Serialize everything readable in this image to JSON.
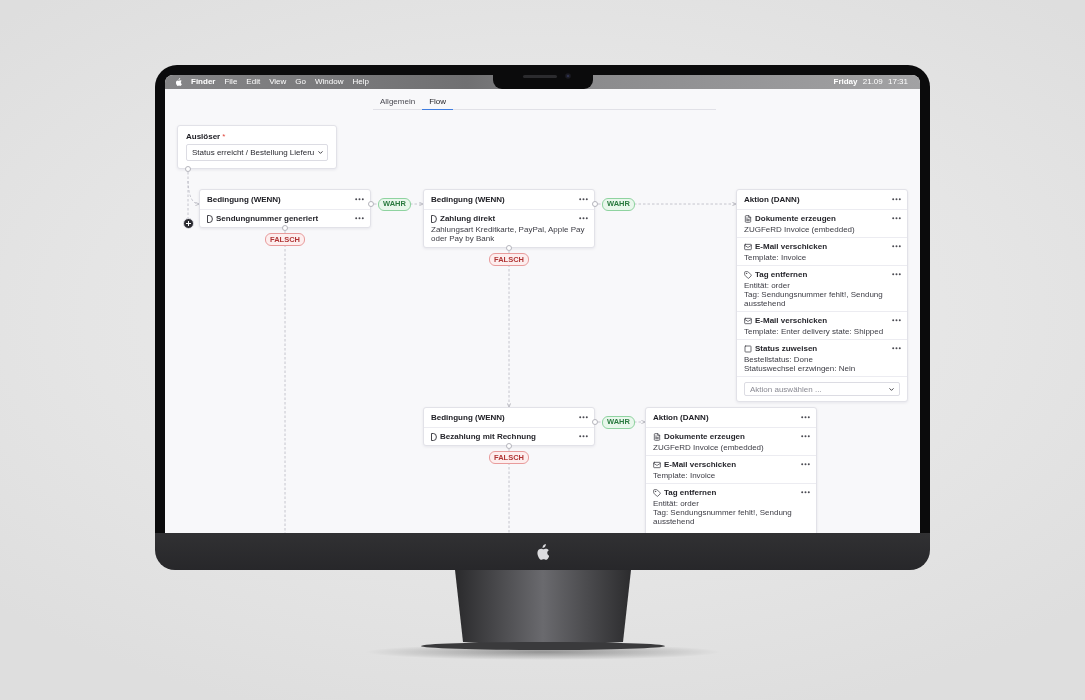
{
  "menu_bar": {
    "app_name": "Finder",
    "menus": [
      "File",
      "Edit",
      "View",
      "Go",
      "Window",
      "Help"
    ],
    "clock": "**Friday** 21.09 17:31"
  },
  "tabs": [
    {
      "label": "Allgemein",
      "selected": false
    },
    {
      "label": "Flow",
      "selected": true
    }
  ],
  "trigger": {
    "label": "Auslöser",
    "required_mark": "*",
    "select": {
      "value": "Status erreicht / Bestellung Lieferu"
    }
  },
  "conditions": [
    {
      "title": "Bedingung (WENN)",
      "rules": [
        {
          "name": "Sendungnummer generiert"
        }
      ],
      "true_label": "WAHR",
      "false_label": "FALSCH"
    },
    {
      "title": "Bedingung (WENN)",
      "rules": [
        {
          "name": "Zahlung direkt",
          "details": "Zahlungsart Kreditkarte, PayPal, Apple Pay oder Pay by Bank"
        }
      ],
      "true_label": "WAHR",
      "false_label": "FALSCH"
    },
    {
      "title": "Bedingung (WENN)",
      "rules": [
        {
          "name": "Bezahlung mit Rechnung"
        }
      ],
      "true_label": "WAHR",
      "false_label": "FALSCH"
    }
  ],
  "actions": [
    {
      "title": "Aktion (DANN)",
      "items": [
        {
          "kind": "documents",
          "name": "Dokumente erzeugen",
          "details": [
            "ZUGFeRD Invoice (embedded)"
          ]
        },
        {
          "kind": "email",
          "name": "E-Mail verschicken",
          "details": [
            "Template: Invoice"
          ]
        },
        {
          "kind": "tag",
          "name": "Tag entfernen",
          "details": [
            "Entität: order",
            "Tag: Sendungsnummer fehlt!, Sendung ausstehend"
          ]
        },
        {
          "kind": "email",
          "name": "E-Mail verschicken",
          "details": [
            "Template: Enter delivery state: Shipped"
          ]
        },
        {
          "kind": "status",
          "name": "Status zuweisen",
          "details": [
            "Bestellstatus: Done",
            "Statuswechsel erzwingen: Nein"
          ]
        }
      ],
      "select": {
        "placeholder": "Aktion auswählen ..."
      }
    },
    {
      "title": "Aktion (DANN)",
      "items": [
        {
          "kind": "documents",
          "name": "Dokumente erzeugen",
          "details": [
            "ZUGFeRD Invoice (embedded)"
          ]
        },
        {
          "kind": "email",
          "name": "E-Mail verschicken",
          "details": [
            "Template: Invoice"
          ]
        },
        {
          "kind": "tag",
          "name": "Tag entfernen",
          "details": [
            "Entität: order",
            "Tag: Sendungsnummer fehlt!, Sendung ausstehend"
          ]
        }
      ]
    }
  ]
}
